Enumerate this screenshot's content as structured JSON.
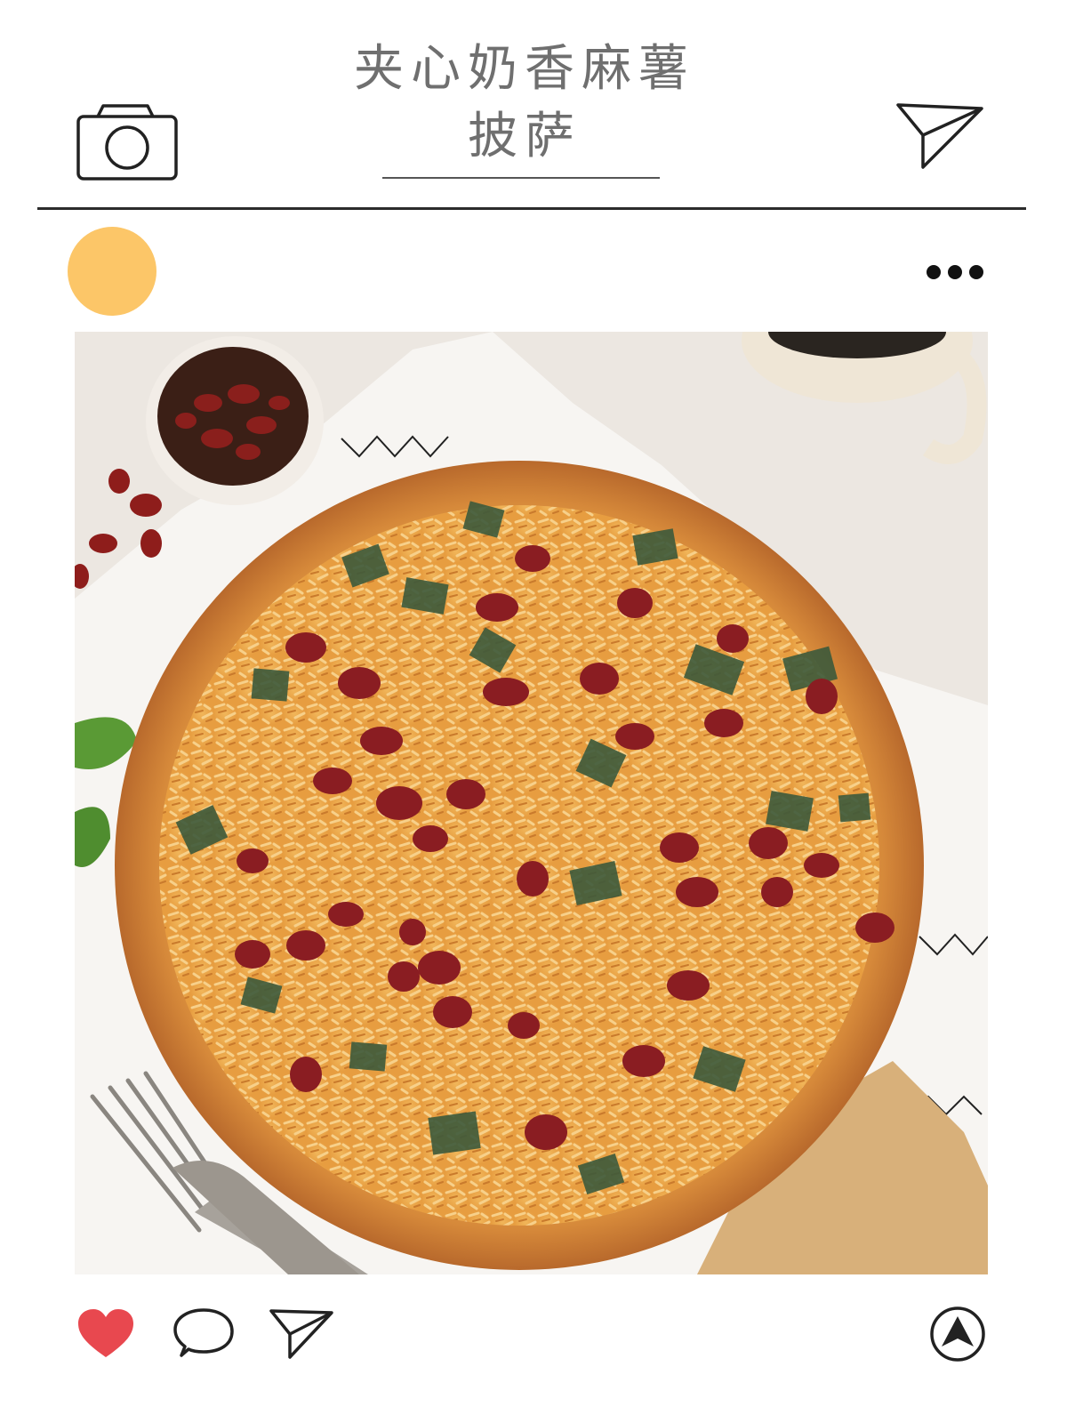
{
  "post": {
    "title_line1": "夹心奶香麻薯",
    "title_line2": "披萨",
    "photo_alt": "夹心奶香麻薯披萨",
    "avatar_color": "#fcc668",
    "accent_like_color": "#e8484f"
  },
  "icons": {
    "top_left": "camera-icon",
    "top_right": "send-icon",
    "menu": "more-dots-icon",
    "actions": [
      "heart-icon",
      "comment-icon",
      "share-icon",
      "navigate-icon"
    ]
  }
}
